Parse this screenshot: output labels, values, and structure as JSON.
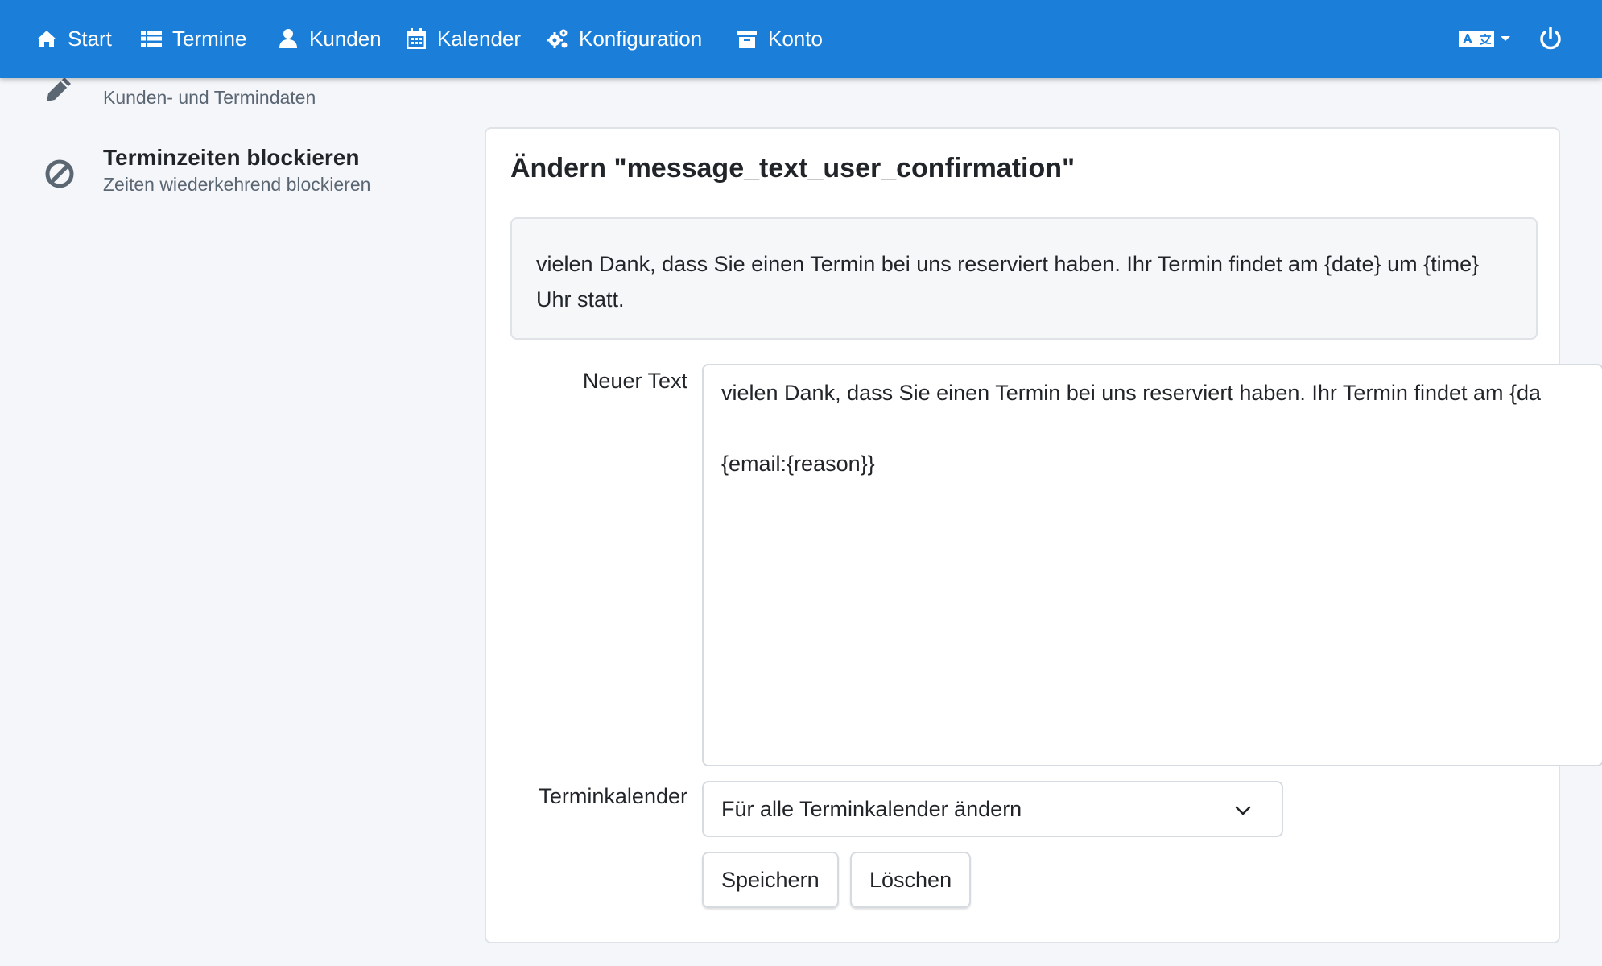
{
  "colors": {
    "navbar": "#1b7fd9",
    "background": "#f4f6f9"
  },
  "navbar": {
    "items": [
      {
        "label": "Start",
        "icon": "home-icon"
      },
      {
        "label": "Termine",
        "icon": "list-icon"
      },
      {
        "label": "Kunden",
        "icon": "user-icon"
      },
      {
        "label": "Kalender",
        "icon": "calendar-icon"
      },
      {
        "label": "Konfiguration",
        "icon": "gears-icon"
      },
      {
        "label": "Konto",
        "icon": "archive-icon"
      }
    ],
    "language_icon": "language-icon",
    "power_icon": "power-icon"
  },
  "sidebar": {
    "items": [
      {
        "title": "",
        "subtitle": "Kunden- und Termindaten",
        "icon": "pencil-icon"
      },
      {
        "title": "Terminzeiten blockieren",
        "subtitle": "Zeiten wiederkehrend blockieren",
        "icon": "ban-icon"
      }
    ]
  },
  "card": {
    "title": "Ändern \"message_text_user_confirmation\"",
    "preview_text": "vielen Dank, dass Sie einen Termin bei uns reserviert haben. Ihr Termin findet am {date} um {time} Uhr statt.",
    "new_text_label": "Neuer Text",
    "new_text_value": "vielen Dank, dass Sie einen Termin bei uns reserviert haben. Ihr Termin findet am {da\n\n{email:{reason}}",
    "calendar_label": "Terminkalender",
    "calendar_selected": "Für alle Terminkalender ändern",
    "save_label": "Speichern",
    "delete_label": "Löschen"
  }
}
